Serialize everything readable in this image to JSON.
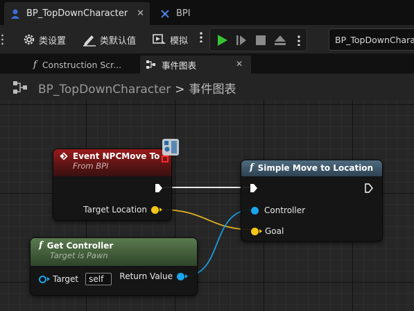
{
  "tabs": [
    {
      "label": "BP_TopDownCharacter",
      "close": "✕"
    },
    {
      "label": "BPI"
    }
  ],
  "toolbar": {
    "class_settings": "类设置",
    "class_defaults": "类默认值",
    "simulate": "模拟",
    "debug_object": "BP_TopDownCharacter"
  },
  "doc_tabs": [
    {
      "label": "Construction Scr...",
      "icon": "function-icon"
    },
    {
      "label": "事件图表",
      "icon": "graph-icon",
      "close": "✕"
    }
  ],
  "breadcrumb": {
    "blueprint": "BP_TopDownCharacter",
    "separator": ">",
    "graph": "事件图表"
  },
  "graph": {
    "nodes": {
      "event": {
        "title": "Event NPCMove To",
        "subtitle": "From BPI",
        "pins": {
          "target_location": "Target Location"
        }
      },
      "simple_move": {
        "title": "Simple Move to Location",
        "pins": {
          "controller": "Controller",
          "goal": "Goal"
        }
      },
      "get_controller": {
        "title": "Get Controller",
        "subtitle": "Target is Pawn",
        "pins": {
          "target": "Target",
          "target_default": "self",
          "return_value": "Return Value"
        }
      }
    }
  },
  "colors": {
    "vector_pin": "#f5c518",
    "object_pin": "#1aa5ec",
    "exec_pin": "#ffffff",
    "event_header": "#9a1a1a",
    "function_header": "#4f6b7f",
    "pure_header": "#5a7a4e",
    "play_green": "#36c236"
  }
}
